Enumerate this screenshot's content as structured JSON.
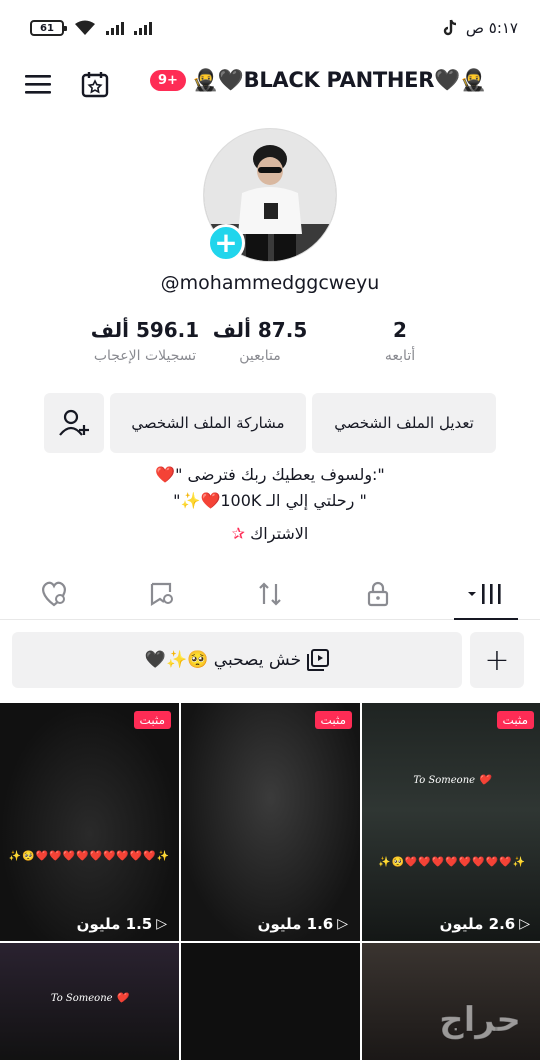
{
  "status_bar": {
    "time": "٥:١٧ ص",
    "battery": "61"
  },
  "header": {
    "notif_count": "9+",
    "title": "🥷🖤BLACK PANTHER🖤🥷"
  },
  "profile": {
    "handle": "@mohammedggcweyu"
  },
  "stats": {
    "following": {
      "value": "2",
      "label": "أتابعه"
    },
    "followers": {
      "value": "87.5 ألف",
      "label": "متابعين"
    },
    "likes": {
      "value": "596.1 ألف",
      "label": "تسجيلات الإعجاب"
    }
  },
  "actions": {
    "edit_profile": "تعديل الملف الشخصي",
    "share_profile": "مشاركة الملف الشخصي"
  },
  "bio": {
    "line1": "\":ولسوف يعطيك ربك فترضى \"❤️",
    "line2": "\" رحلتي إلي الـ 100K❤️✨\""
  },
  "subscription": {
    "label": "الاشتراك"
  },
  "playlist": {
    "label": "خش يصحبي 🥺✨🖤"
  },
  "videos": [
    {
      "pinned": "مثبت",
      "views": "1.5 مليون",
      "overlay": "✨🥺❤️❤️❤️❤️❤️❤️❤️❤️❤️✨"
    },
    {
      "pinned": "مثبت",
      "views": "1.6 مليون"
    },
    {
      "pinned": "مثبت",
      "views": "2.6 مليون",
      "overlay": "✨🥺❤️❤️❤️❤️❤️❤️❤️❤️✨",
      "caption": "To Someone ❤️"
    },
    {
      "caption": "To Someone ❤️"
    },
    {},
    {}
  ],
  "watermark": {
    "text": "حراج"
  }
}
